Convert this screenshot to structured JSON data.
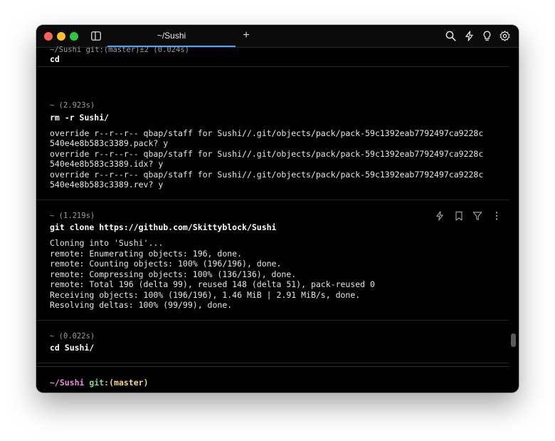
{
  "window": {
    "tab_title": "~/Sushi",
    "new_tab_label": "+"
  },
  "icons": {
    "search": "search-icon",
    "lightning": "lightning-icon",
    "lightbulb": "lightbulb-icon",
    "settings": "gear-icon"
  },
  "blocks": [
    {
      "meta": "~/Sushi git:(master)±2 (0.024s)",
      "command": "cd",
      "output": []
    },
    {
      "meta": "~ (2.923s)",
      "command": "rm -r Sushi/",
      "output": [
        "override r--r--r-- qbap/staff for Sushi//.git/objects/pack/pack-59c1392eab7792497ca9228c",
        "540e4e8b583c3389.pack? y",
        "override r--r--r-- qbap/staff for Sushi//.git/objects/pack/pack-59c1392eab7792497ca9228c",
        "540e4e8b583c3389.idx? y",
        "override r--r--r-- qbap/staff for Sushi//.git/objects/pack/pack-59c1392eab7792497ca9228c",
        "540e4e8b583c3389.rev? y"
      ]
    },
    {
      "meta": "~ (1.219s)",
      "command": "git clone https://github.com/Skittyblock/Sushi",
      "output": [
        "Cloning into 'Sushi'...",
        "remote: Enumerating objects: 196, done.",
        "remote: Counting objects: 100% (196/196), done.",
        "remote: Compressing objects: 100% (136/136), done.",
        "remote: Total 196 (delta 99), reused 148 (delta 51), pack-reused 0",
        "Receiving objects: 100% (196/196), 1.46 MiB | 2.91 MiB/s, done.",
        "Resolving deltas: 100% (99/99), done."
      ]
    },
    {
      "meta": "~ (0.022s)",
      "command": "cd Sushi/",
      "output": []
    }
  ],
  "prompt": {
    "path": "~/Sushi",
    "git_label": "git:",
    "branch": "(master)"
  },
  "colors": {
    "prompt_path": "#e88ce0",
    "prompt_git": "#7ee08a",
    "prompt_branch": "#f2d98a",
    "tab_underline": "#4da3ff"
  }
}
